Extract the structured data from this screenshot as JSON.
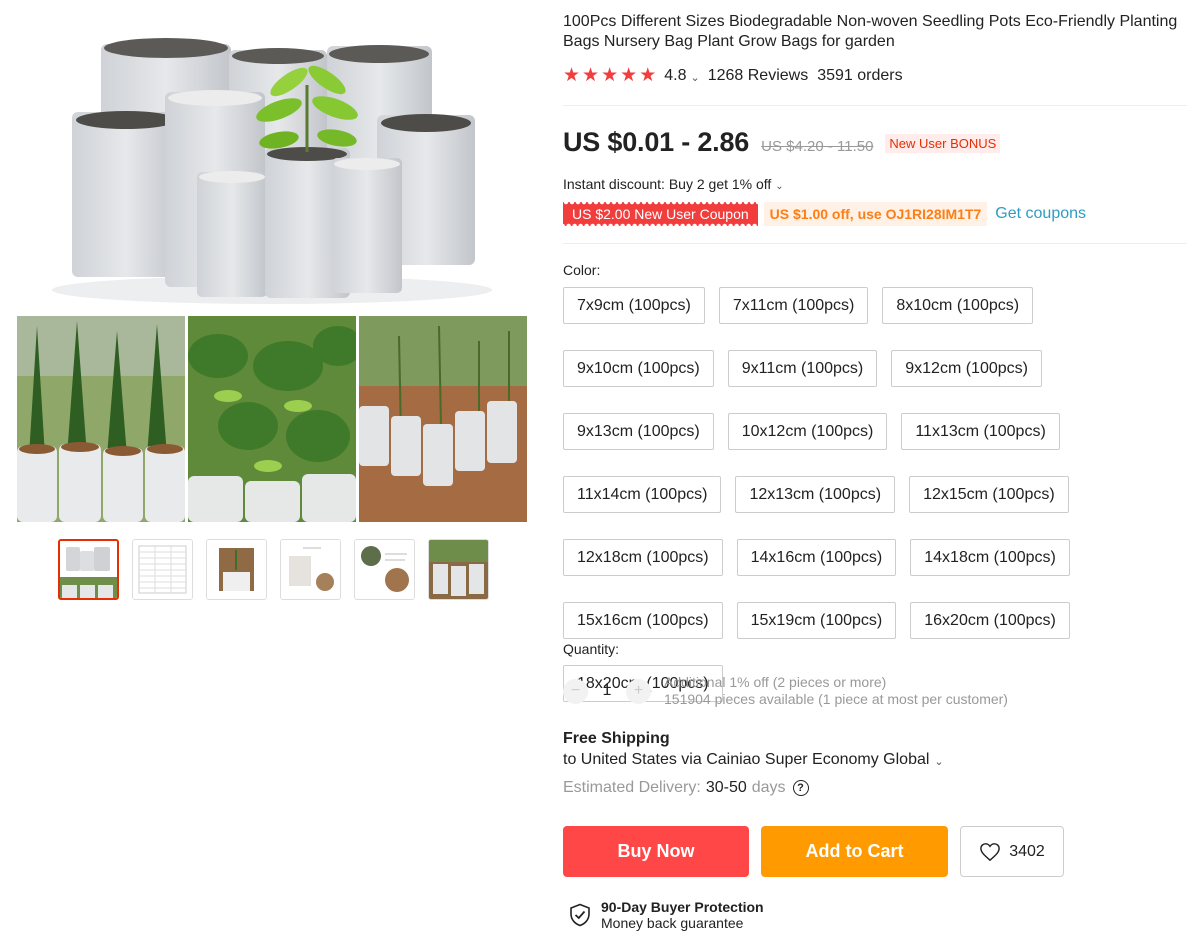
{
  "product": {
    "title": "100Pcs Different Sizes Biodegradable Non-woven Seedling Pots Eco-Friendly Planting Bags Nursery Bag Plant Grow Bags for garden",
    "rating": "4.8",
    "reviews": "1268 Reviews",
    "orders": "3591 orders",
    "star_color": "#f23d3d"
  },
  "price": {
    "current": "US $0.01 - 2.86",
    "original": "US $4.20 - 11.50",
    "badge": "New User BONUS"
  },
  "discount": {
    "instant": "Instant discount: Buy 2 get 1% off",
    "coupon_red": "US $2.00 New User Coupon",
    "coupon_orange": "US $1.00 off, use OJ1RI28IM1T7",
    "get_coupons": "Get coupons"
  },
  "color": {
    "label": "Color:",
    "options": [
      "7x9cm (100pcs)",
      "7x11cm (100pcs)",
      "8x10cm (100pcs)",
      "9x10cm (100pcs)",
      "9x11cm (100pcs)",
      "9x12cm (100pcs)",
      "9x13cm (100pcs)",
      "10x12cm (100pcs)",
      "11x13cm (100pcs)",
      "11x14cm (100pcs)",
      "12x13cm (100pcs)",
      "12x15cm (100pcs)",
      "12x18cm (100pcs)",
      "14x16cm (100pcs)",
      "14x18cm (100pcs)",
      "15x16cm (100pcs)",
      "15x19cm (100pcs)",
      "16x20cm (100pcs)",
      "18x20cm (100pcs)"
    ]
  },
  "quantity": {
    "label": "Quantity:",
    "minus": "−",
    "plus": "+",
    "value": "1",
    "extra_off": "Additional 1% off (2 pieces or more)",
    "available": "151904 pieces available (1 piece at most per customer)"
  },
  "shipping": {
    "title": "Free Shipping",
    "to": "to United States via Cainiao Super Economy Global",
    "delivery_label": "Estimated Delivery:",
    "delivery_value": "30-50",
    "delivery_unit": "days"
  },
  "actions": {
    "buy_now": "Buy Now",
    "add_to_cart": "Add to Cart",
    "wishlist_count": "3402",
    "buy_color": "#ff4747",
    "cart_color": "#ff9a00"
  },
  "protection": {
    "title": "90-Day Buyer Protection",
    "subtitle": "Money back guarantee"
  },
  "gallery": {
    "thumbnail_count": 6,
    "active_thumbnail": 1
  }
}
